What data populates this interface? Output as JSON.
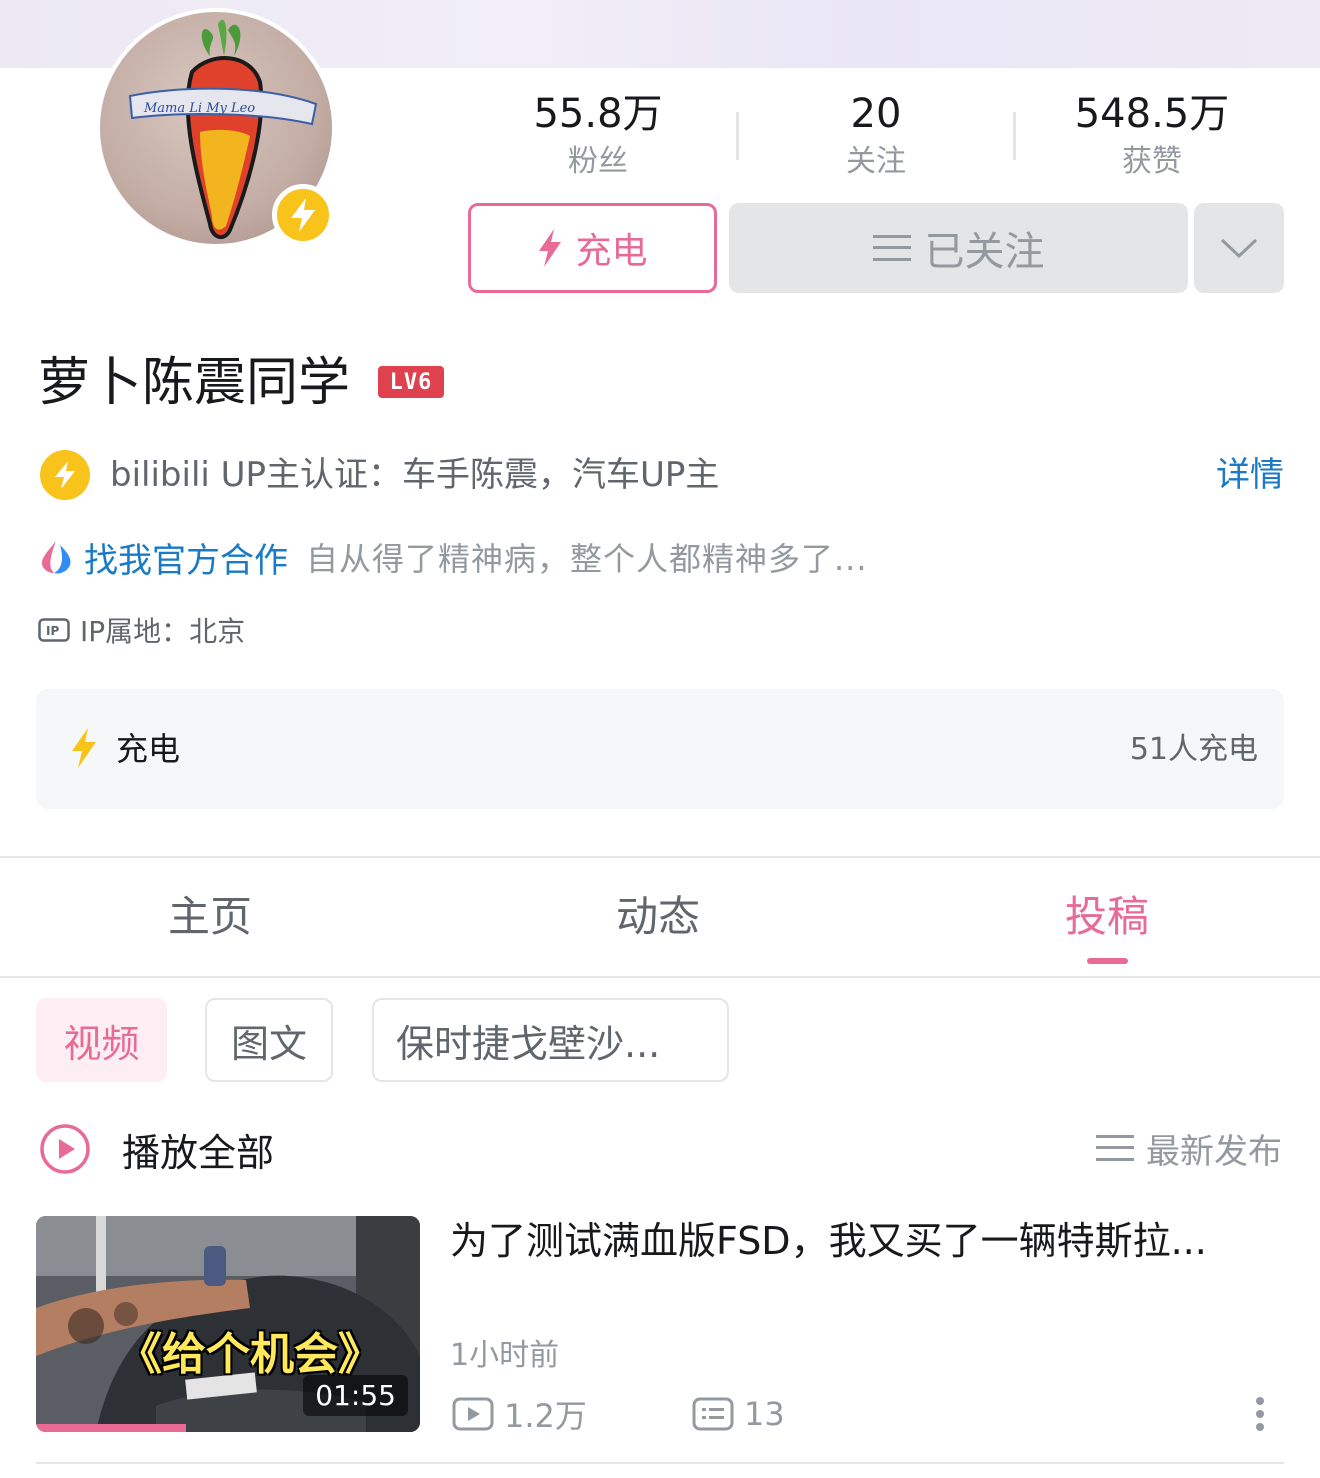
{
  "profile": {
    "username": "萝卜陈震同学",
    "level": "LV6",
    "verify_text": "bilibili UP主认证：车手陈震，汽车UP主",
    "detail_label": "详情",
    "bio_link": "找我官方合作",
    "bio": "自从得了精神病，整个人都精神多了...",
    "ip": "IP属地：北京"
  },
  "stats": [
    {
      "value": "55.8万",
      "label": "粉丝"
    },
    {
      "value": "20",
      "label": "关注"
    },
    {
      "value": "548.5万",
      "label": "获赞"
    }
  ],
  "actions": {
    "charge_label": "充电",
    "follow_label": "已关注"
  },
  "charge_card": {
    "label": "充电",
    "count": "51人充电"
  },
  "tabs": [
    {
      "label": "主页",
      "active": false
    },
    {
      "label": "动态",
      "active": false
    },
    {
      "label": "投稿",
      "active": true
    }
  ],
  "chips": [
    "视频",
    "图文",
    "保时捷戈壁沙..."
  ],
  "list_header": {
    "play_all": "播放全部",
    "sort": "最新发布"
  },
  "videos": [
    {
      "title": "为了测试满血版FSD，我又买了一辆特斯拉...",
      "thumb_caption": "《给个机会》",
      "duration": "01:55",
      "time": "1小时前",
      "plays": "1.2万",
      "comments": "13",
      "watch_progress": 0.39
    }
  ],
  "colors": {
    "accent_pink": "#e86b95",
    "link_blue": "#1a7ac5",
    "badge_yellow": "#f8c31b",
    "level_red": "#e0414e"
  },
  "icons": [
    "lightning-icon",
    "menu-lines-icon",
    "chevron-down-icon",
    "ip-icon",
    "play-circle-icon",
    "play-count-icon",
    "comment-icon",
    "more-vertical-icon",
    "cooperation-logo-icon"
  ]
}
